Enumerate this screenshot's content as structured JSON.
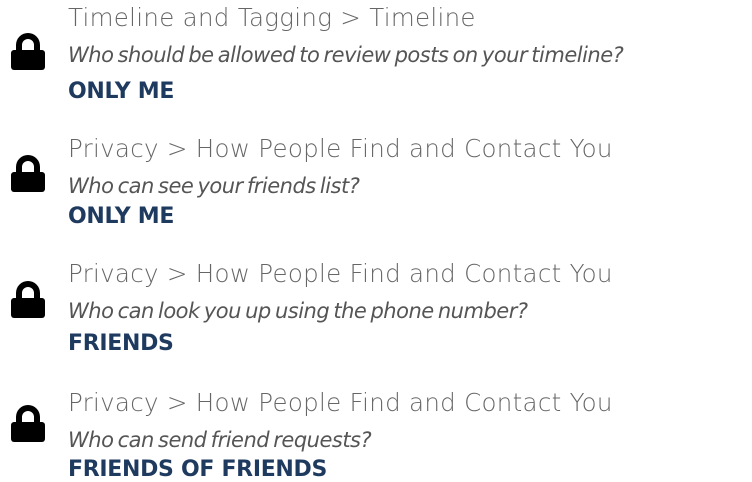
{
  "settings": [
    {
      "path": "Timeline and Tagging > Timeline",
      "question": "Who should be allowed to review posts on your timeline?",
      "answer": "ONLY ME",
      "icon": "lock-icon"
    },
    {
      "path": "Privacy > How People Find and Contact You",
      "question": "Who can see your friends list?",
      "answer": "ONLY ME",
      "icon": "lock-icon"
    },
    {
      "path": "Privacy > How People Find and Contact You",
      "question": "Who can look you up using the phone number?",
      "answer": "FRIENDS",
      "icon": "lock-icon"
    },
    {
      "path": "Privacy > How People Find and Contact You",
      "question": "Who can send friend requests?",
      "answer": "FRIENDS OF FRIENDS",
      "icon": "lock-icon"
    }
  ],
  "colors": {
    "lock": "#000000",
    "path_text": "#666666",
    "question_text": "#555555",
    "answer_text": "#1f3a5f"
  }
}
